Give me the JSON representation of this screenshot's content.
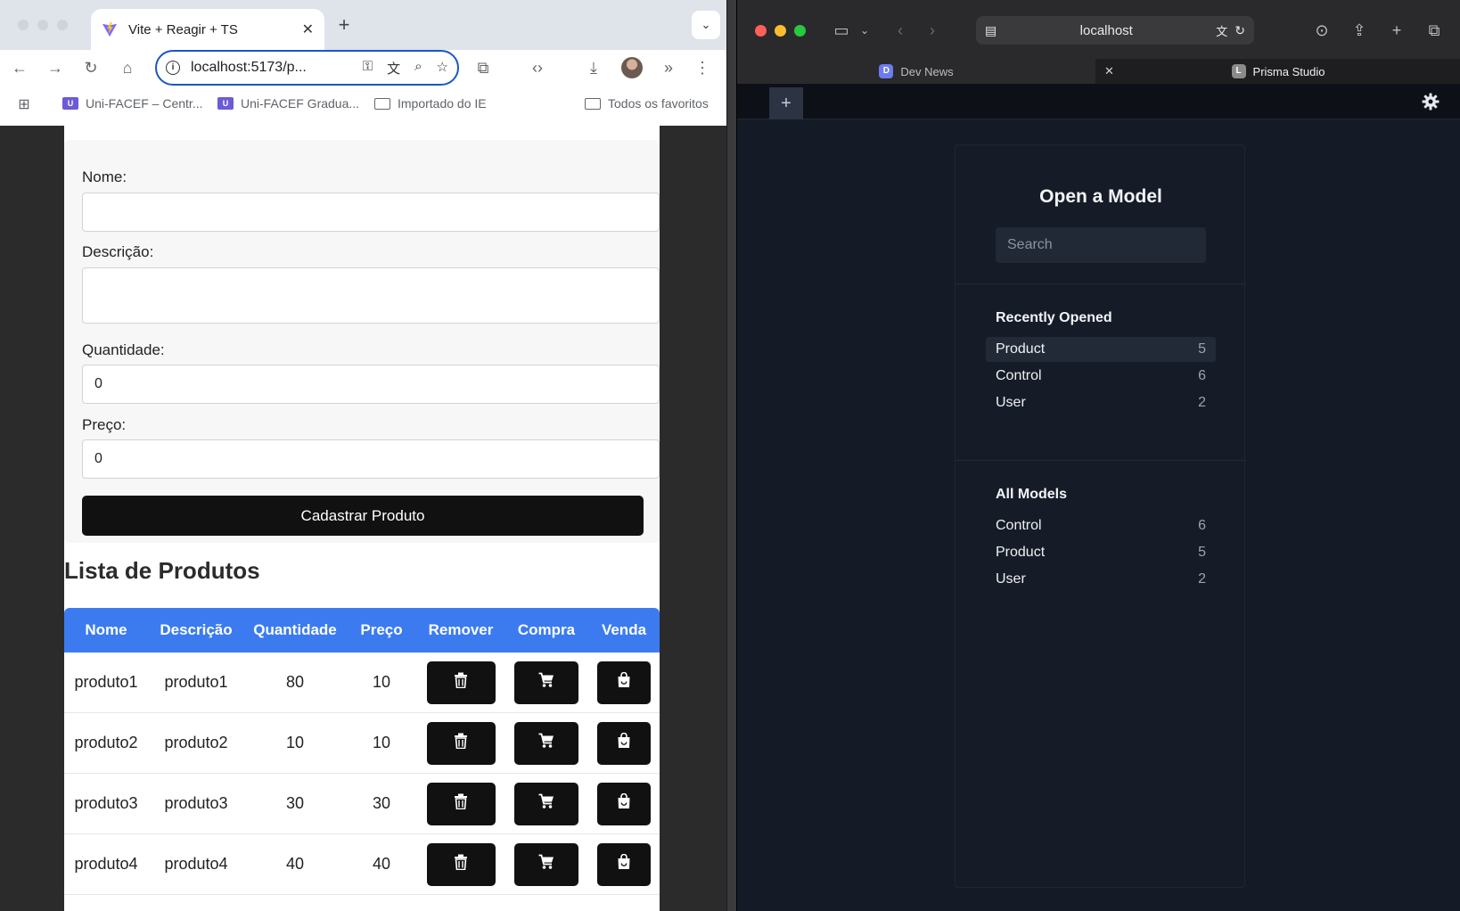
{
  "chrome": {
    "tab_title": "Vite + Reagir + TS",
    "tab_close": "✕",
    "new_tab": "+",
    "tab_list": "⌄",
    "url": "localhost:5173/p...",
    "bookmarks": [
      {
        "label": "Uni-FACEF – Centr..."
      },
      {
        "label": "Uni-FACEF Gradua..."
      },
      {
        "label": "Importado do IE"
      },
      {
        "label": "Todos os favoritos"
      }
    ]
  },
  "form": {
    "nome_label": "Nome:",
    "nome_value": "",
    "descricao_label": "Descrição:",
    "descricao_value": "",
    "quantidade_label": "Quantidade:",
    "quantidade_value": "0",
    "preco_label": "Preço:",
    "preco_value": "0",
    "submit_label": "Cadastrar Produto"
  },
  "product_list": {
    "title": "Lista de Produtos",
    "headers": [
      "Nome",
      "Descrição",
      "Quantidade",
      "Preço",
      "Remover",
      "Compra",
      "Venda"
    ],
    "rows": [
      {
        "nome": "produto1",
        "descricao": "produto1",
        "quantidade": "80",
        "preco": "10"
      },
      {
        "nome": "produto2",
        "descricao": "produto2",
        "quantidade": "10",
        "preco": "10"
      },
      {
        "nome": "produto3",
        "descricao": "produto3",
        "quantidade": "30",
        "preco": "30"
      },
      {
        "nome": "produto4",
        "descricao": "produto4",
        "quantidade": "40",
        "preco": "40"
      }
    ],
    "actions": {
      "remove_icon": "trash-icon",
      "buy_icon": "cart-icon",
      "sell_icon": "shopping-bag-icon"
    }
  },
  "safari": {
    "address": "localhost",
    "tabs": [
      {
        "label": "Dev News",
        "favicon": "D"
      },
      {
        "label": "Prisma Studio",
        "favicon": "L"
      }
    ],
    "tab_close": "✕"
  },
  "prisma": {
    "add_tab": "+",
    "panel_title": "Open a Model",
    "search_placeholder": "Search",
    "recently_opened_title": "Recently Opened",
    "recently_opened": [
      {
        "name": "Product",
        "count": "5"
      },
      {
        "name": "Control",
        "count": "6"
      },
      {
        "name": "User",
        "count": "2"
      }
    ],
    "all_models_title": "All Models",
    "all_models": [
      {
        "name": "Control",
        "count": "6"
      },
      {
        "name": "Product",
        "count": "5"
      },
      {
        "name": "User",
        "count": "2"
      }
    ]
  },
  "colors": {
    "table_header": "#3b7bef",
    "action_button": "#111111",
    "prisma_bg": "#151b26",
    "omnibox_focus": "#1a56c8"
  }
}
